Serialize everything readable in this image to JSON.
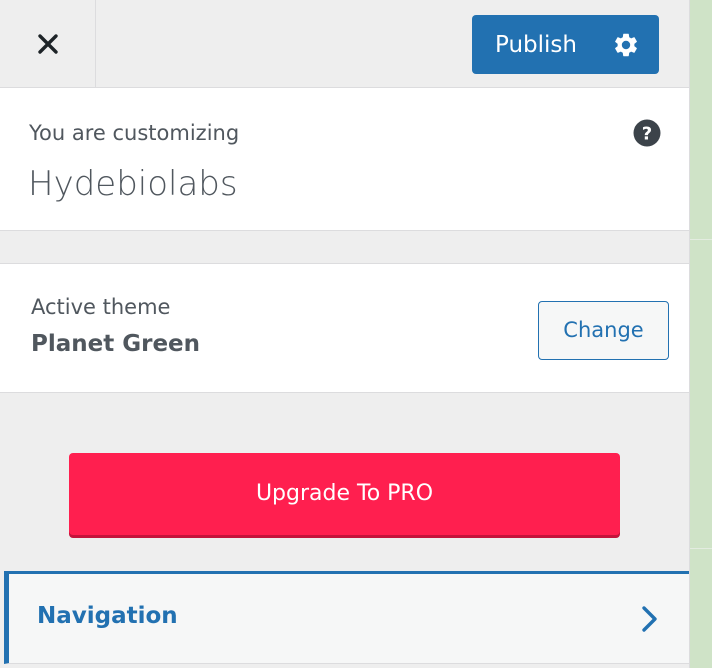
{
  "header": {
    "close_icon": "close-icon",
    "publish_label": "Publish",
    "settings_icon": "gear-icon"
  },
  "info": {
    "action": "You are customizing",
    "site_title": "Hydebiolabs",
    "help_icon": "question-icon"
  },
  "theme": {
    "label": "Active theme",
    "name": "Planet Green",
    "change_label": "Change"
  },
  "upgrade": {
    "label": "Upgrade To PRO"
  },
  "sections": [
    {
      "label": "Navigation",
      "icon": "chevron-right-icon"
    }
  ],
  "colors": {
    "accent": "#2271b1",
    "upgrade": "#ff1f4f",
    "panel_bg": "#eeeeee",
    "preview_bg": "#cfe3c7"
  }
}
